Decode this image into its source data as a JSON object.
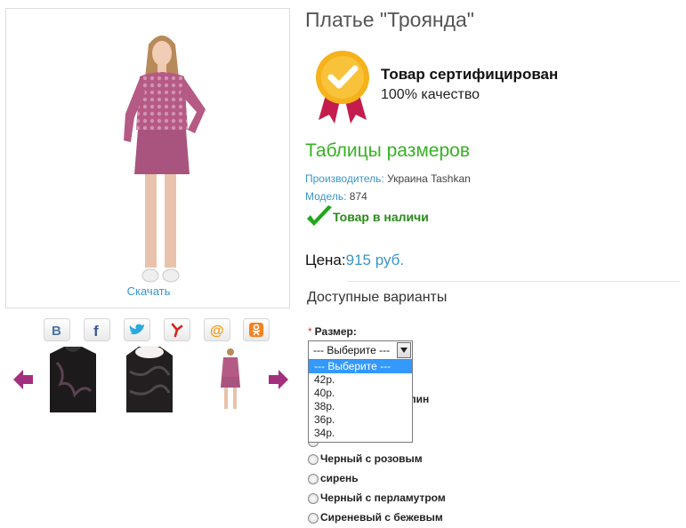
{
  "product": {
    "title": "Платье \"Троянда\"",
    "download_label": "Скачать"
  },
  "certificate": {
    "title": "Товар сертифицирован",
    "subtitle": "100% качество"
  },
  "size_tables_link": "Таблицы размеров",
  "meta": {
    "manufacturer_label": "Производитель:",
    "manufacturer_value": "Украина Tashkan",
    "model_label": "Модель:",
    "model_value": "874"
  },
  "stock_status": "Товар в наличи",
  "price": {
    "label": "Цена:",
    "value": "915 руб."
  },
  "options": {
    "heading": "Доступные варианты",
    "size_label": "Размер:",
    "size_required_mark": "*",
    "size_selected": "--- Выберите ---",
    "size_options": [
      "--- Выберите ---",
      "42р.",
      "40р.",
      "38р.",
      "36р.",
      "34р."
    ],
    "color_partial_visible": "лин",
    "colors": [
      "Черный с розовым",
      "сирень",
      "Черный с перламутром",
      "Сиреневый с бежевым"
    ]
  },
  "social_icons": [
    "vk-icon",
    "facebook-icon",
    "twitter-icon",
    "ya-icon",
    "mail-icon",
    "odnoklassniki-icon"
  ],
  "colors_palette": {
    "accent_blue": "#3a95c8",
    "link_green": "#37b223",
    "stock_green": "#2a8a1a",
    "arrow_purple": "#a3307e",
    "select_highlight": "#3399ff"
  }
}
